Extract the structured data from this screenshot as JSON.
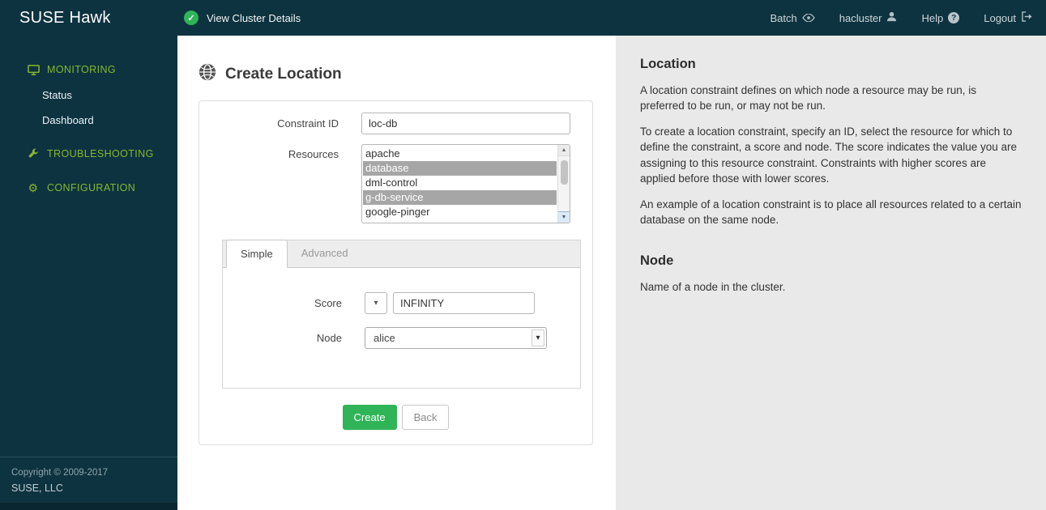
{
  "colors": {
    "brand_dark": "#0d3340",
    "sidebar_green": "#86b72e",
    "button_green": "#2fb457",
    "selected_option_bg": "#a6a6a6",
    "help_panel_bg": "#e9e9e9"
  },
  "icons": {
    "check": "✓",
    "caret_down": "▾",
    "scroll_up": "▲",
    "scroll_down": "▼",
    "help_glyph": "?",
    "gear_glyph": "⚙"
  },
  "sidebar": {
    "logo": "SUSE Hawk",
    "sections": [
      {
        "label": "MONITORING",
        "icon": "monitor-icon",
        "items": [
          {
            "label": "Status"
          },
          {
            "label": "Dashboard"
          }
        ]
      },
      {
        "label": "TROUBLESHOOTING",
        "icon": "wrench-icon",
        "items": []
      },
      {
        "label": "CONFIGURATION",
        "icon": "gear-icon",
        "items": []
      }
    ],
    "copyright": [
      "Copyright © 2009-2017",
      "SUSE, LLC"
    ]
  },
  "topbar": {
    "status_label": "View Cluster Details",
    "items": [
      {
        "label": "Batch",
        "icon": "eye-icon"
      },
      {
        "label": "hacluster",
        "icon": "user-icon"
      },
      {
        "label": "Help",
        "icon": "question-icon"
      },
      {
        "label": "Logout",
        "icon": "logout-icon"
      }
    ]
  },
  "main": {
    "title": "Create Location",
    "form": {
      "constraint_id_label": "Constraint ID",
      "constraint_id_value": "loc-db",
      "resources_label": "Resources",
      "resources_options": [
        {
          "label": "apache",
          "selected": false
        },
        {
          "label": "database",
          "selected": true
        },
        {
          "label": "dml-control",
          "selected": false
        },
        {
          "label": "g-db-service",
          "selected": true
        },
        {
          "label": "google-pinger",
          "selected": false
        }
      ],
      "tabs": [
        {
          "label": "Simple",
          "active": true
        },
        {
          "label": "Advanced",
          "active": false
        }
      ],
      "score_label": "Score",
      "score_value": "INFINITY",
      "node_label": "Node",
      "node_value": "alice",
      "create_button": "Create",
      "back_button": "Back"
    }
  },
  "help_panel": {
    "sections": [
      {
        "title": "Location",
        "paragraphs": [
          "A location constraint defines on which node a resource may be run, is preferred to be run, or may not be run.",
          "To create a location constraint, specify an ID, select the resource for which to define the constraint, a score and node. The score indicates the value you are assigning to this resource constraint. Constraints with higher scores are applied before those with lower scores.",
          "An example of a location constraint is to place all resources related to a certain database on the same node."
        ]
      },
      {
        "title": "Node",
        "paragraphs": [
          "Name of a node in the cluster."
        ]
      }
    ]
  }
}
